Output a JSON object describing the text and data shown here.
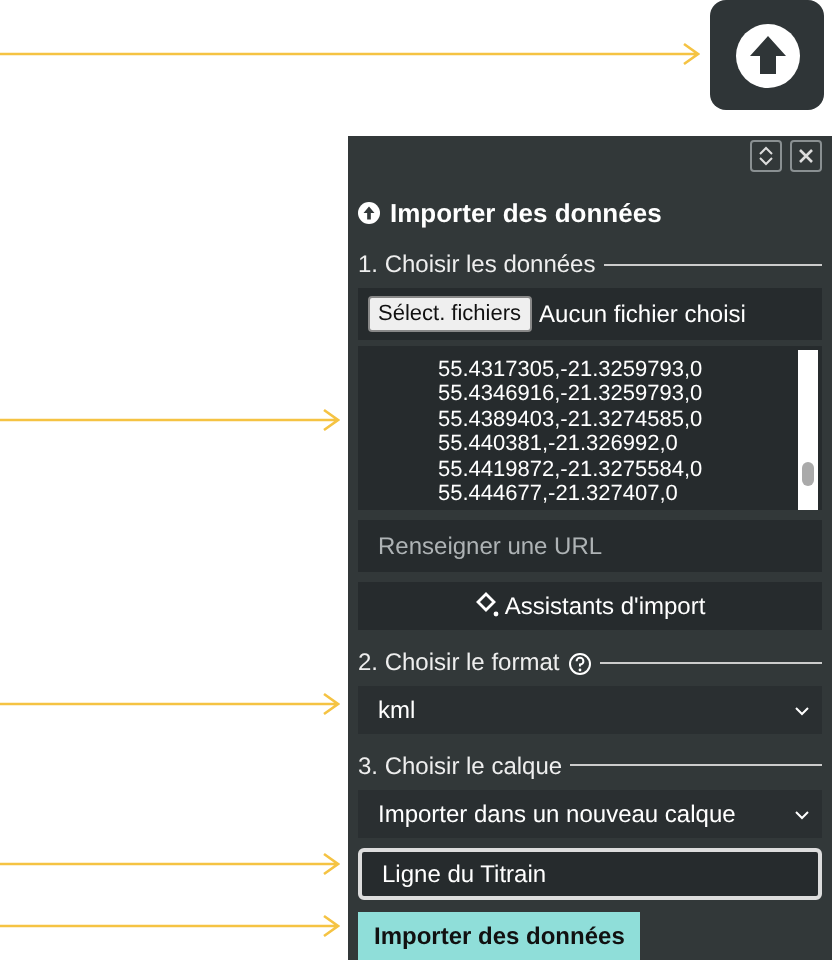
{
  "upload_button": {
    "kind": "upload"
  },
  "panel": {
    "title": "Importer des données",
    "step_1": {
      "legend": "1. Choisir les données",
      "file_button": "Sélect. fichiers",
      "file_status": "Aucun fichier choisi",
      "text_lines": [
        "55.4317305,-21.3259793,0",
        "55.4346916,-21.3259793,0",
        "55.4389403,-21.3274585,0",
        "55.440381,-21.326992,0",
        "55.4419872,-21.3275584,0",
        "55.444677,-21.327407,0"
      ],
      "url_placeholder": "Renseigner une URL",
      "assistants_button": "Assistants d'import"
    },
    "step_2": {
      "legend": "2. Choisir le format",
      "help": true,
      "value": "kml"
    },
    "step_3": {
      "legend": "3. Choisir le calque",
      "value": "Importer dans un nouveau calque",
      "name_value": "Ligne du Titrain"
    },
    "submit": "Importer des données"
  }
}
